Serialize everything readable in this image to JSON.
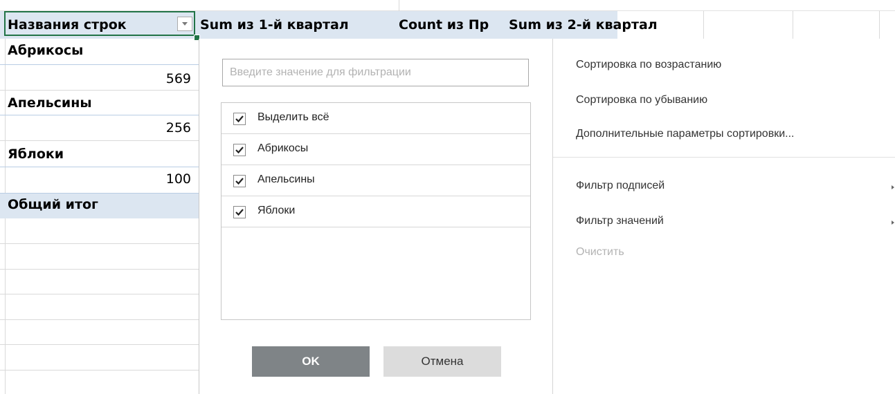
{
  "table": {
    "headers": {
      "row_labels": "Названия строк",
      "sum_q1": "Sum из 1-й квартал",
      "count_pr": "Count из Пр",
      "sum_q2": "Sum из 2-й квартал"
    },
    "rows": [
      {
        "label": "Абрикосы",
        "value": "569"
      },
      {
        "label": "Апельсины",
        "value": "256"
      },
      {
        "label": "Яблоки",
        "value": "100"
      }
    ],
    "grand_total": "Общий итог"
  },
  "filter_popup": {
    "search_placeholder": "Введите значение для фильтрации",
    "items": [
      {
        "label": "Выделить всё",
        "checked": true
      },
      {
        "label": "Абрикосы",
        "checked": true
      },
      {
        "label": "Апельсины",
        "checked": true
      },
      {
        "label": "Яблоки",
        "checked": true
      }
    ],
    "ok_label": "OK",
    "cancel_label": "Отмена",
    "menu": {
      "sort_asc": "Сортировка по возрастанию",
      "sort_desc": "Сортировка по убыванию",
      "sort_more": "Дополнительные параметры сортировки...",
      "label_filter": "Фильтр подписей",
      "value_filter": "Фильтр значений",
      "clear": "Очистить"
    }
  },
  "colors": {
    "header_band": "#dce6f1",
    "active_cell_border": "#217346",
    "ok_button": "#7f8487",
    "cancel_button": "#dcdcdc"
  }
}
